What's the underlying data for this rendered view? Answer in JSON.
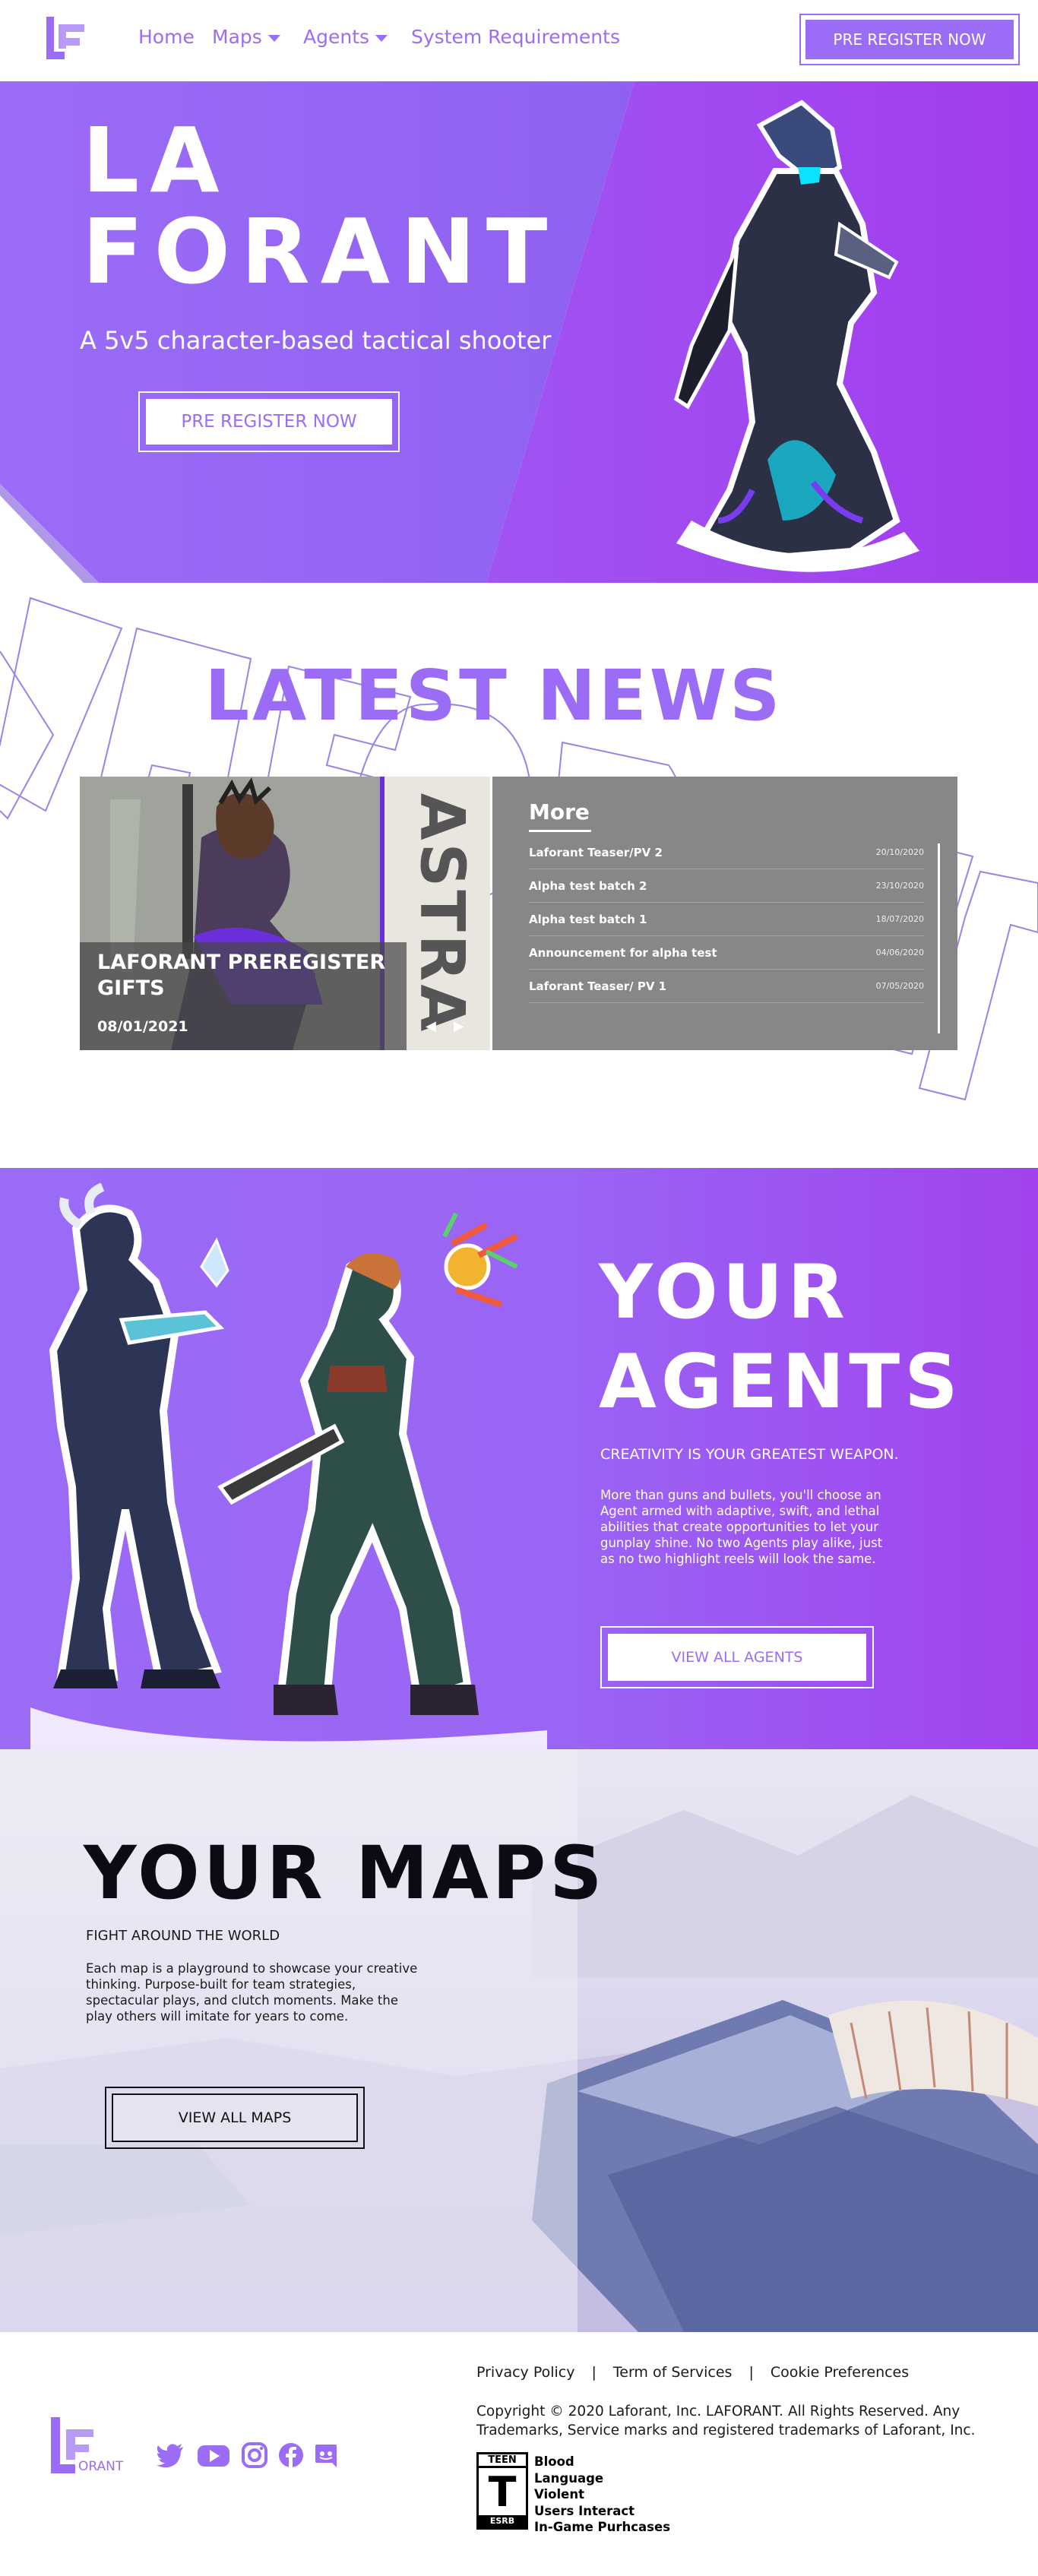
{
  "nav": {
    "links": [
      {
        "label": "Home"
      },
      {
        "label": "Maps"
      },
      {
        "label": "Agents"
      },
      {
        "label": "System Requirements"
      }
    ],
    "cta_label": "PRE REGISTER NOW"
  },
  "hero": {
    "title_line1": "LA",
    "title_line2": "FORANT",
    "subtitle": "A 5v5 character-based tactical shooter",
    "cta_label": "PRE REGISTER NOW"
  },
  "news": {
    "title": "LATEST NEWS",
    "watermark": "LAFORANT",
    "featured": {
      "headline": "LAFORANT PREREGISTER GIFTS",
      "date": "08/01/2021",
      "poster_text": "ASTRA"
    },
    "more": {
      "title": "More",
      "items": [
        {
          "title": "Laforant Teaser/PV 2",
          "date": "20/10/2020"
        },
        {
          "title": "Alpha test batch 2",
          "date": "23/10/2020"
        },
        {
          "title": "Alpha test batch 1",
          "date": "18/07/2020"
        },
        {
          "title": "Announcement for alpha test",
          "date": "04/06/2020"
        },
        {
          "title": "Laforant Teaser/ PV 1",
          "date": "07/05/2020"
        }
      ]
    }
  },
  "agents": {
    "title_line1": "YOUR",
    "title_line2": "AGENTS",
    "tagline": "CREATIVITY IS YOUR GREATEST WEAPON.",
    "description": "More than guns and bullets, you'll choose an Agent armed with adaptive, swift, and lethal abilities that create opportunities to let your gunplay shine. No two Agents play alike, just as no two highlight reels will look the same.",
    "cta_label": "VIEW ALL AGENTS"
  },
  "maps": {
    "title": "YOUR MAPS",
    "tagline": "FIGHT AROUND THE WORLD",
    "description": "Each map is a playground to showcase your creative thinking. Purpose-built for team strategies, spectacular plays, and clutch moments. Make the play others will imitate for years to come.",
    "cta_label": "VIEW ALL MAPS"
  },
  "footer": {
    "links": [
      "Privacy Policy",
      "Term of Services",
      "Cookie Preferences"
    ],
    "separator": "|",
    "copyright": "Copyright © 2020 Laforant, Inc.  LAFORANT. All Rights Reserved. Any Trademarks, Service marks and registered trademarks of Laforant, Inc.",
    "logo_text": "ORANT",
    "rating": {
      "top": "TEEN",
      "letter": "T",
      "bottom": "ESRB",
      "descriptors": [
        "Blood",
        "Language",
        "Violent",
        "Users Interact",
        "In-Game Purhcases"
      ]
    },
    "social_icons": [
      "twitter-icon",
      "youtube-icon",
      "instagram-icon",
      "facebook-icon",
      "discord-icon"
    ]
  },
  "colors": {
    "brand": "#9b6cf5",
    "brand_dark": "#a143ee",
    "news_panel": "#878787"
  }
}
